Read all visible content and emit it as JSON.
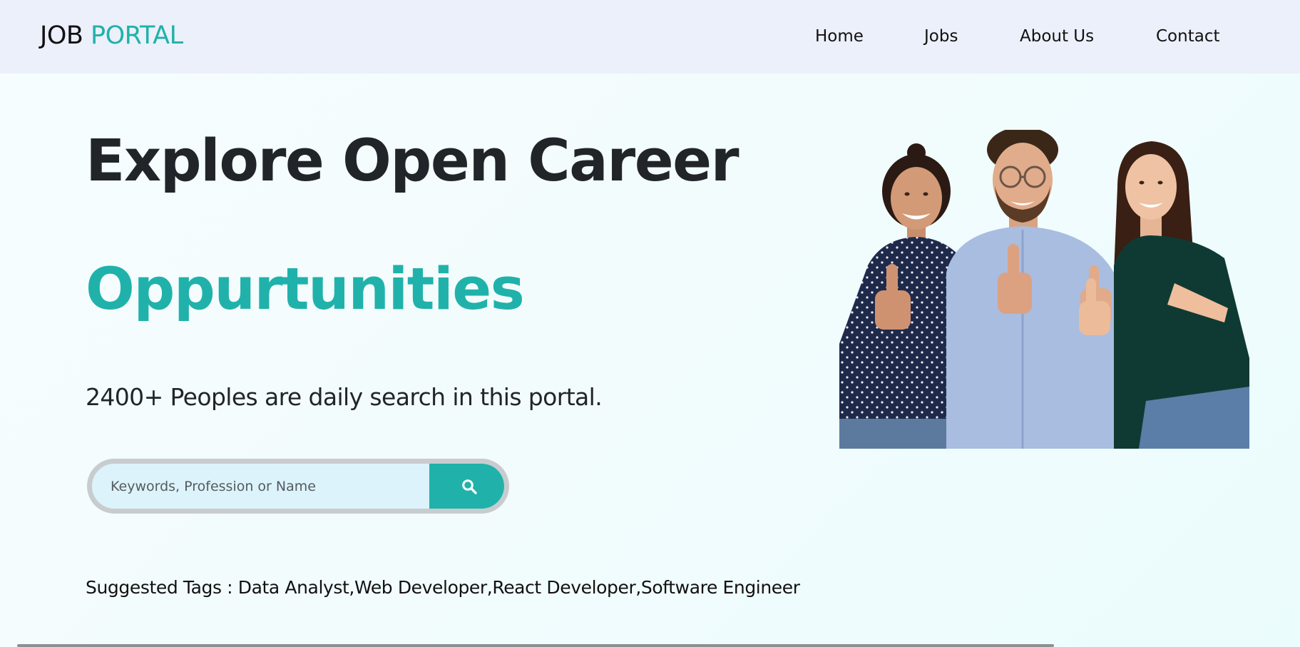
{
  "brand": {
    "word1": "JOB",
    "word2": "PORTAL"
  },
  "nav": {
    "items": [
      "Home",
      "Jobs",
      "About Us",
      "Contact"
    ]
  },
  "hero": {
    "title": "Explore Open Career",
    "subtitle": "Oppurtunities",
    "tagline": "2400+ Peoples are daily search in this portal."
  },
  "search": {
    "placeholder": "Keywords, Profession or Name",
    "button_icon": "search-icon"
  },
  "tags": {
    "prefix": "Suggested Tags : ",
    "items": [
      "Data Analyst",
      "Web Developer",
      "React Developer",
      "Software Engineer"
    ],
    "separator": ","
  },
  "image": {
    "alt": "three people giving thumbs up"
  },
  "colors": {
    "accent": "#20b2aa",
    "navbar_bg": "#ebf0fa",
    "text_dark": "#212529",
    "search_bg": "#dcf3fb",
    "search_border": "#c9ccce"
  }
}
